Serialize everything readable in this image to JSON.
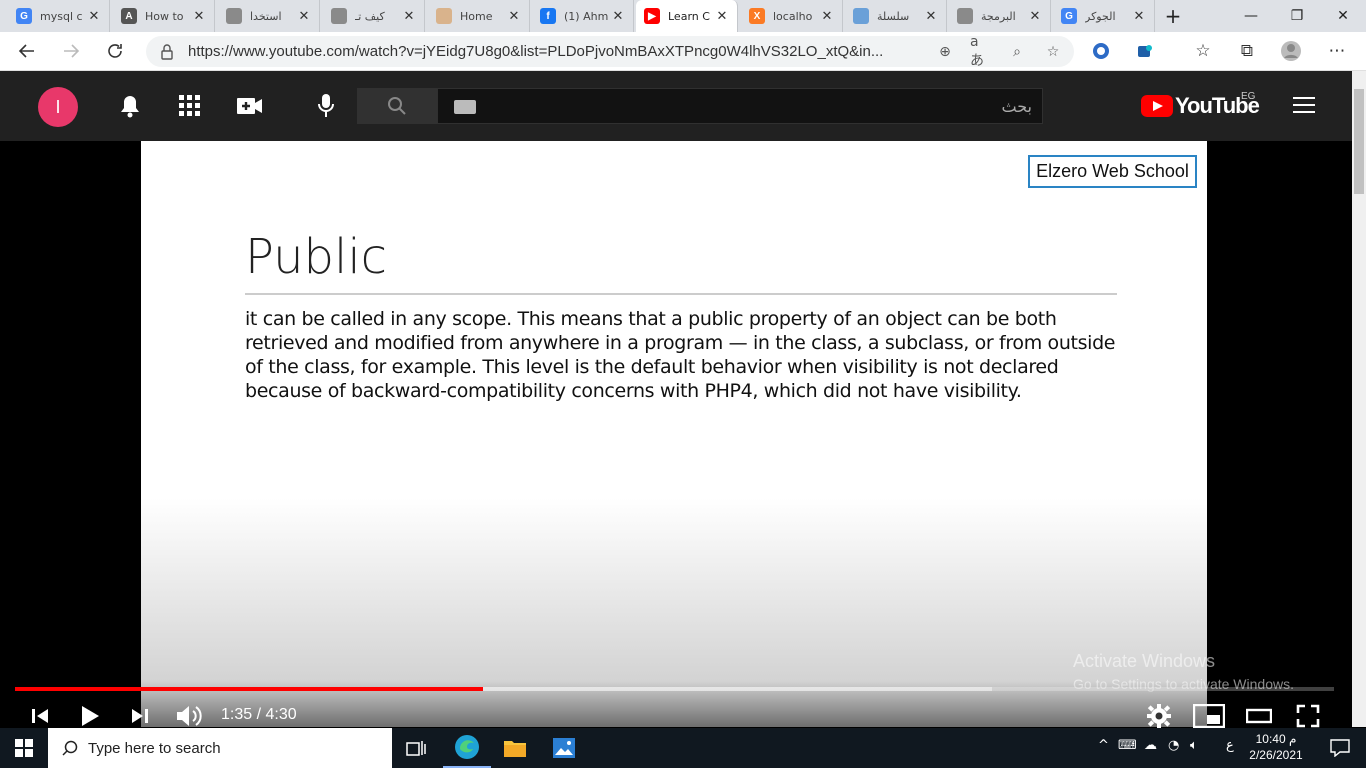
{
  "browser": {
    "tabs": [
      {
        "title": "mysql c",
        "favicon": "google-icon",
        "color": "#4285f4",
        "letter": "G"
      },
      {
        "title": "How to",
        "favicon": "generic-icon",
        "color": "#555555",
        "letter": "A"
      },
      {
        "title": "استخدا",
        "favicon": "page-icon",
        "color": "#8a8a8a",
        "letter": ""
      },
      {
        "title": "كيف تـ",
        "favicon": "page-icon",
        "color": "#8a8a8a",
        "letter": ""
      },
      {
        "title": "Home",
        "favicon": "wp-icon",
        "color": "#d9b38c",
        "letter": ""
      },
      {
        "title": "(1) Ahm",
        "favicon": "facebook-icon",
        "color": "#1877f2",
        "letter": "f"
      },
      {
        "title": "Learn C",
        "favicon": "youtube-icon",
        "color": "#ff0000",
        "letter": "▶"
      },
      {
        "title": "localho",
        "favicon": "xampp-icon",
        "color": "#fb7a24",
        "letter": "X"
      },
      {
        "title": "سلسلة",
        "favicon": "shield-icon",
        "color": "#6aa0d8",
        "letter": ""
      },
      {
        "title": "البرمجة",
        "favicon": "page-icon",
        "color": "#8a8a8a",
        "letter": ""
      },
      {
        "title": "الجوكر",
        "favicon": "google-icon",
        "color": "#4285f4",
        "letter": "G"
      }
    ],
    "active_tab_index": 6,
    "new_tab": "+",
    "window_controls": {
      "minimize": "—",
      "restore": "❐",
      "close": "✕"
    },
    "url": "https://www.youtube.com/watch?v=jYEidg7U8g0&list=PLDoPjvoNmBAxXTPncg0W4lhVS32LO_xtQ&in..."
  },
  "youtube": {
    "avatar_letter": "I",
    "search_placeholder": "بحث",
    "logo_text": "YouTube",
    "region": "EG"
  },
  "slide": {
    "brand": "Elzero Web School",
    "title": "Public",
    "body": "it can be called in any scope. This means that a public property of an object can be both retrieved and modified from anywhere in a program — in the class, a subclass, or from outside of the class, for example. This level is the default behavior when visibility is not declared because of backward-compatibility concerns with PHP4, which did not have visibility."
  },
  "player": {
    "time": "1:35 / 4:30",
    "played_fraction": 0.3545,
    "buffered_fraction": 0.7406
  },
  "watermark": {
    "line1": "Activate Windows",
    "line2": "Go to Settings to activate Windows."
  },
  "taskbar": {
    "search_placeholder": "Type here to search",
    "time": "10:40 م",
    "date": "2/26/2021",
    "lang": "ع"
  },
  "colors": {
    "youtube_red": "#ff0000",
    "avatar": "#e8386a",
    "brand_border": "#2a84c4"
  }
}
